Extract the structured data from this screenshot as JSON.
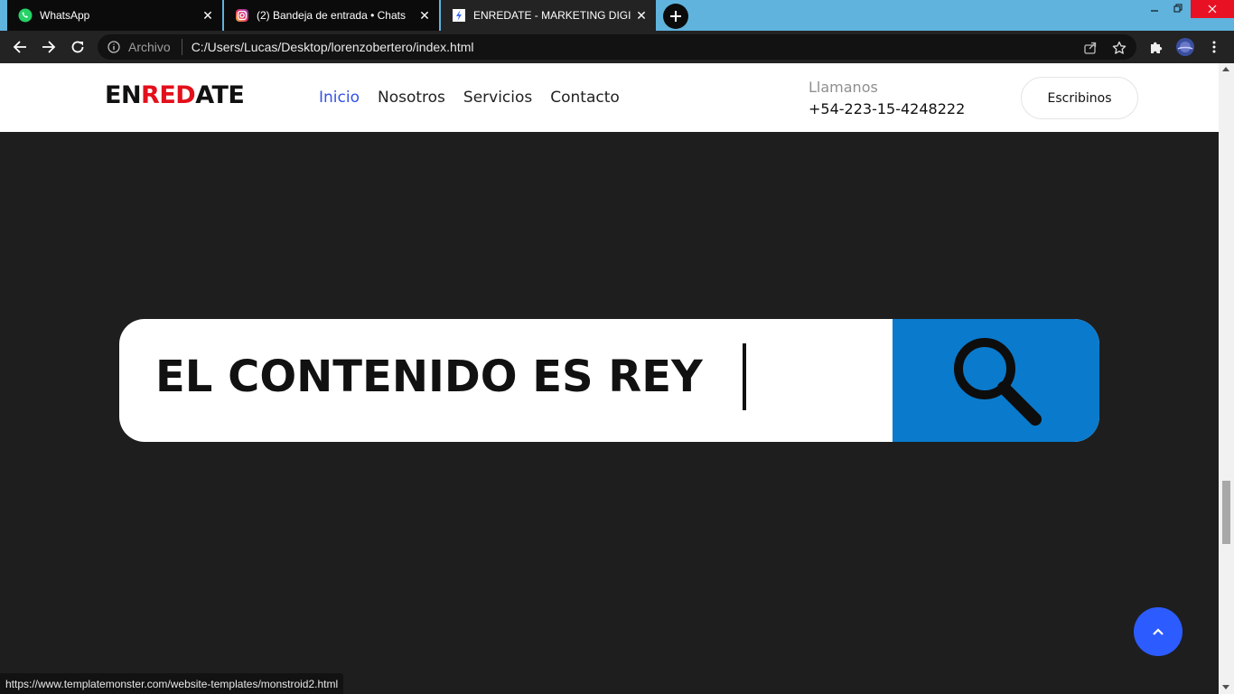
{
  "browser": {
    "tabs": [
      {
        "title": "WhatsApp",
        "favicon": "whatsapp-icon",
        "close": "✕"
      },
      {
        "title": "(2) Bandeja de entrada • Chats",
        "favicon": "instagram-icon",
        "close": "✕"
      },
      {
        "title": "ENREDATE - MARKETING DIGITAL",
        "favicon": "page-favicon-icon",
        "close": "✕"
      }
    ],
    "address": {
      "scheme_label": "Archivo",
      "url": "C:/Users/Lucas/Desktop/lorenzobertero/index.html"
    },
    "status_url": "https://www.templatemonster.com/website-templates/monstroid2.html"
  },
  "site": {
    "logo": {
      "part1": "EN",
      "part2": "RED",
      "part3": "ATE"
    },
    "nav": [
      "Inicio",
      "Nosotros",
      "Servicios",
      "Contacto"
    ],
    "call_label": "Llamanos",
    "phone": "+54-223-15-4248222",
    "cta": "Escribinos",
    "hero_text": "EL CONTENIDO ES REY"
  },
  "colors": {
    "tabstrip": "#5fb3dd",
    "nav_active": "#3450e6",
    "logo_red": "#e3101c",
    "search_blue": "#0a7acc",
    "to_top": "#2c5cff",
    "page_bg": "#1e1e1e"
  }
}
